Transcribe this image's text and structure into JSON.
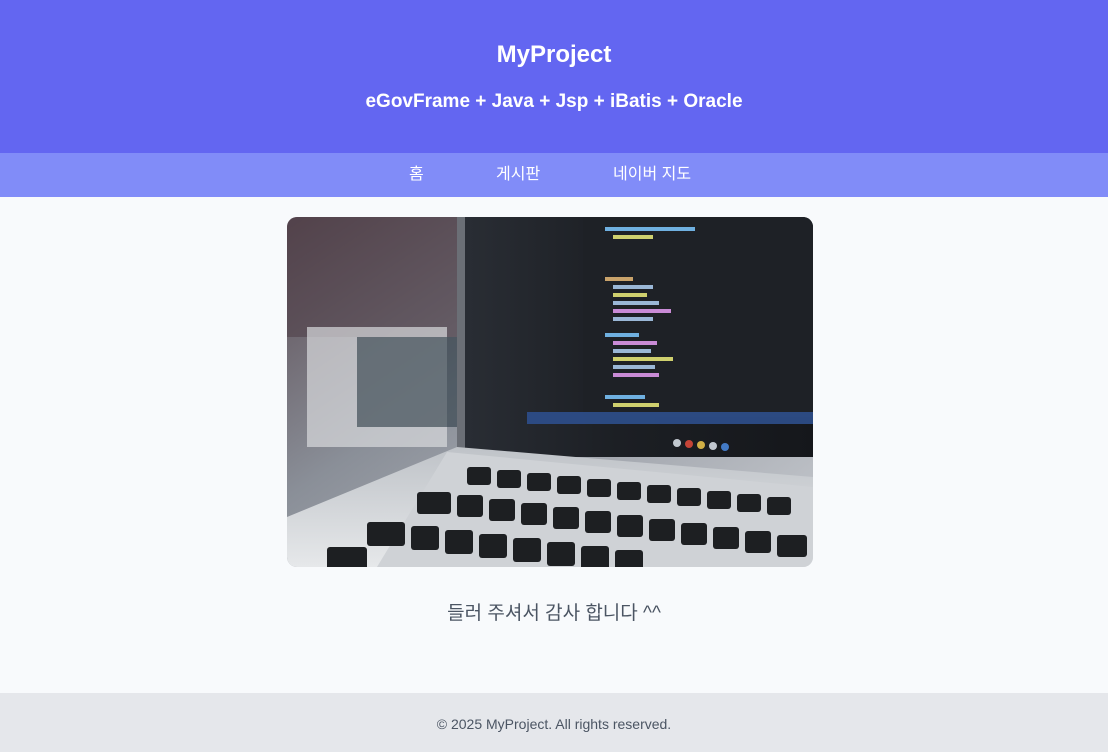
{
  "header": {
    "title": "MyProject",
    "subtitle": "eGovFrame + Java + Jsp + iBatis + Oracle"
  },
  "nav": {
    "items": [
      {
        "label": "홈"
      },
      {
        "label": "게시판"
      },
      {
        "label": "네이버 지도"
      }
    ]
  },
  "main": {
    "hero_image": "laptop-with-code-editor-photo",
    "message": "들러 주셔서 감사 합니다 ^^"
  },
  "footer": {
    "copyright": "© 2025 MyProject. All rights reserved."
  },
  "colors": {
    "header_bg": "#6366f1",
    "nav_bg": "#818cf8",
    "page_bg": "#f8fafc",
    "footer_bg": "#e5e7eb",
    "text_muted": "#4b5563"
  }
}
